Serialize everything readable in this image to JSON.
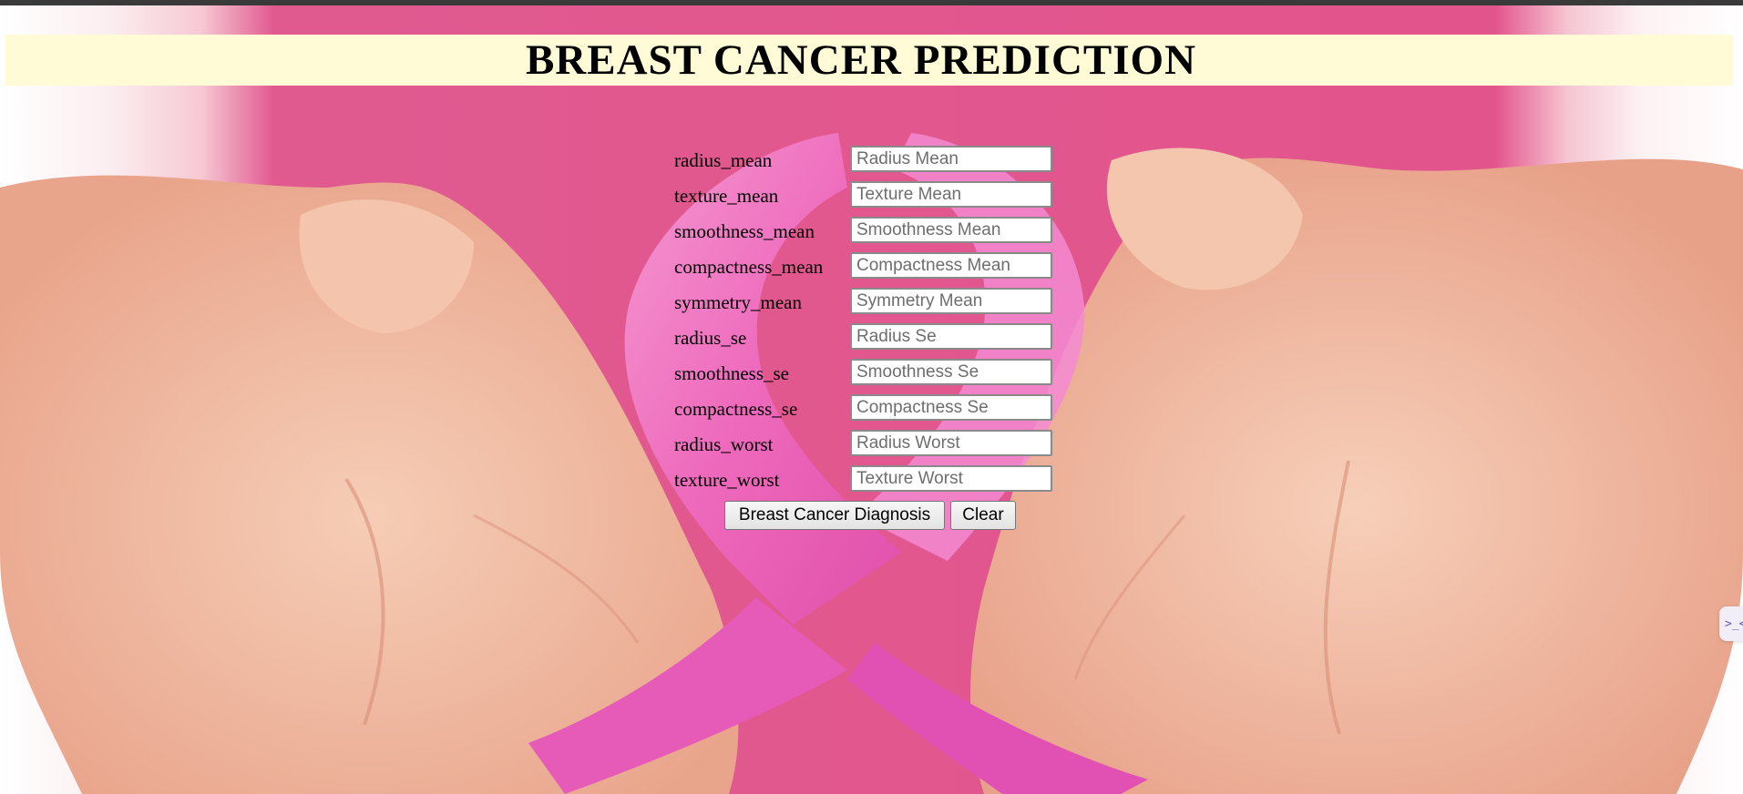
{
  "header": {
    "title": "BREAST CANCER PREDICTION"
  },
  "form": {
    "fields": [
      {
        "label": "radius_mean",
        "placeholder": "Radius Mean",
        "value": ""
      },
      {
        "label": "texture_mean",
        "placeholder": "Texture Mean",
        "value": ""
      },
      {
        "label": "smoothness_mean",
        "placeholder": "Smoothness Mean",
        "value": ""
      },
      {
        "label": "compactness_mean",
        "placeholder": "Compactness Mean",
        "value": ""
      },
      {
        "label": "symmetry_mean",
        "placeholder": "Symmetry Mean",
        "value": ""
      },
      {
        "label": "radius_se",
        "placeholder": "Radius Se",
        "value": ""
      },
      {
        "label": "smoothness_se",
        "placeholder": "Smoothness Se",
        "value": ""
      },
      {
        "label": "compactness_se",
        "placeholder": "Compactness Se",
        "value": ""
      },
      {
        "label": "radius_worst",
        "placeholder": "Radius Worst",
        "value": ""
      },
      {
        "label": "texture_worst",
        "placeholder": "Texture Worst",
        "value": ""
      }
    ],
    "submit_label": "Breast Cancer Diagnosis",
    "clear_label": "Clear"
  },
  "floating_widget": {
    "icon": "assistant-widget-icon",
    "glyph": ">_<"
  },
  "colors": {
    "banner_bg": "#fffbd6",
    "shirt_pink": "#e2548c",
    "ribbon_pink": "#f06cc4",
    "skin": "#f3c0a6"
  }
}
